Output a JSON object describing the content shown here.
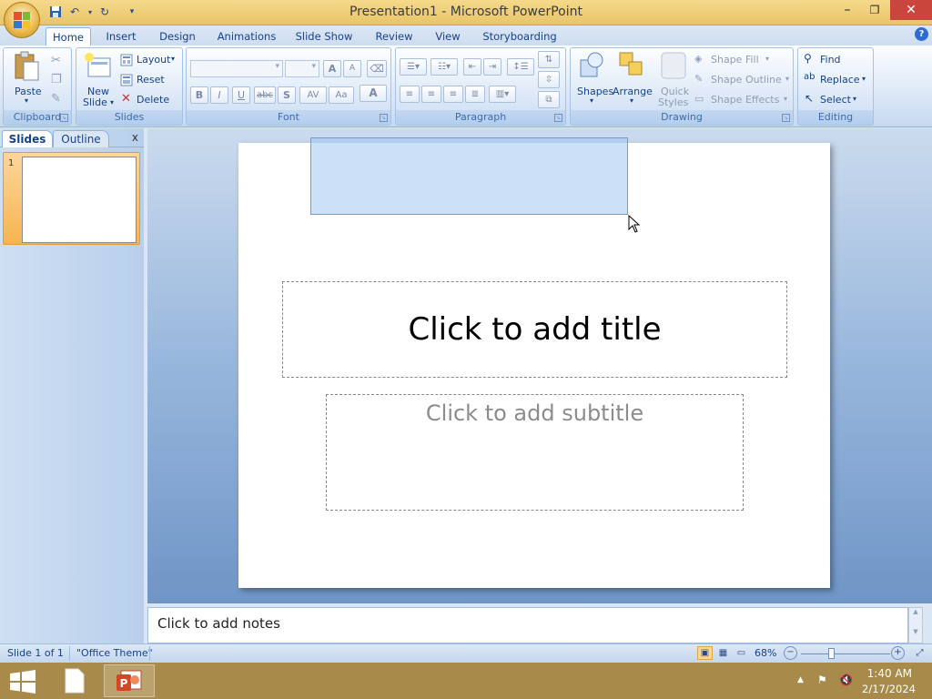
{
  "window": {
    "title": "Presentation1 - Microsoft PowerPoint",
    "minimize": "–",
    "maximize": "❐",
    "close": "✕"
  },
  "quick_access": {
    "save_icon": "save-icon",
    "undo_icon": "undo-icon",
    "redo_icon": "redo-icon",
    "customize_icon": "chevron-down-icon"
  },
  "tabs": [
    {
      "label": "Home"
    },
    {
      "label": "Insert"
    },
    {
      "label": "Design"
    },
    {
      "label": "Animations"
    },
    {
      "label": "Slide Show"
    },
    {
      "label": "Review"
    },
    {
      "label": "View"
    },
    {
      "label": "Storyboarding"
    }
  ],
  "ribbon": {
    "clipboard": {
      "label": "Clipboard",
      "paste": "Paste"
    },
    "slides": {
      "label": "Slides",
      "new_slide_1": "New",
      "new_slide_2": "Slide",
      "layout": "Layout",
      "reset": "Reset",
      "delete": "Delete"
    },
    "font": {
      "label": "Font",
      "bold": "B",
      "italic": "I",
      "underline": "U",
      "strike": "abc",
      "shadow": "S",
      "spacing": "AV",
      "case": "Aa",
      "color": "A",
      "grow": "A",
      "shrink": "A"
    },
    "paragraph": {
      "label": "Paragraph"
    },
    "drawing": {
      "label": "Drawing",
      "shapes": "Shapes",
      "arrange": "Arrange",
      "quick_styles_1": "Quick",
      "quick_styles_2": "Styles",
      "shape_fill": "Shape Fill",
      "shape_outline": "Shape Outline",
      "shape_effects": "Shape Effects"
    },
    "editing": {
      "label": "Editing",
      "find": "Find",
      "replace": "Replace",
      "select": "Select"
    }
  },
  "left_pane": {
    "tab_slides": "Slides",
    "tab_outline": "Outline",
    "close": "x",
    "slide_number": "1"
  },
  "slide": {
    "title_placeholder": "Click to add title",
    "subtitle_placeholder": "Click to add subtitle"
  },
  "notes": {
    "placeholder": "Click to add notes"
  },
  "status": {
    "slide_info": "Slide 1 of 1",
    "theme": "\"Office Theme\"",
    "zoom": "68%",
    "zoom_level": 0.68
  },
  "taskbar": {
    "time": "1:40 AM",
    "date": "2/17/2024"
  },
  "colors": {
    "accent": "#15428b",
    "title_bar": "#e9c46a",
    "selection": "#a0c8f0",
    "taskbar": "#a88b4a"
  }
}
